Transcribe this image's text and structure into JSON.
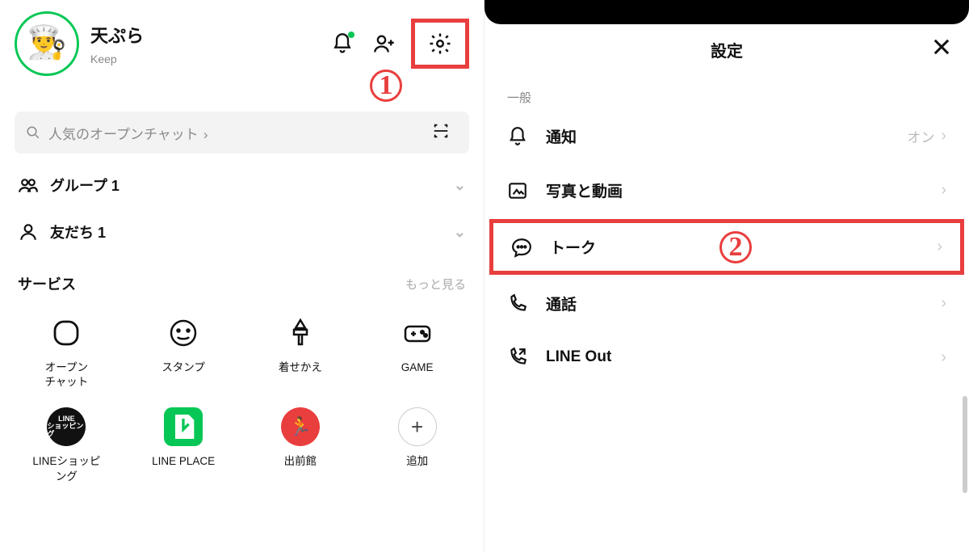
{
  "colors": {
    "accent_green": "#06C755",
    "annotation_red": "#E93E3E"
  },
  "annotations": {
    "step1": "1",
    "step2": "2"
  },
  "left": {
    "profile": {
      "name": "天ぷら",
      "keep": "Keep"
    },
    "search_placeholder": "人気のオープンチャット",
    "rows": {
      "groups": "グループ 1",
      "friends": "友だち 1"
    },
    "section": {
      "title": "サービス",
      "more": "もっと見る"
    },
    "services": [
      {
        "id": "openchat",
        "label": "オープン\nチャット"
      },
      {
        "id": "stamp",
        "label": "スタンプ"
      },
      {
        "id": "theme",
        "label": "着せかえ"
      },
      {
        "id": "game",
        "label": "GAME"
      },
      {
        "id": "shopping",
        "label": "LINEショッピ\nング",
        "pill_text_top": "LINE",
        "pill_text_bottom": "ショッピング"
      },
      {
        "id": "place",
        "label": "LINE PLACE"
      },
      {
        "id": "demae",
        "label": "出前館"
      },
      {
        "id": "add",
        "label": "追加"
      }
    ]
  },
  "right": {
    "title": "設定",
    "section_label": "一般",
    "items": [
      {
        "id": "notif",
        "label": "通知",
        "value": "オン"
      },
      {
        "id": "media",
        "label": "写真と動画"
      },
      {
        "id": "talk",
        "label": "トーク",
        "highlighted": true
      },
      {
        "id": "call",
        "label": "通話"
      },
      {
        "id": "lineout",
        "label": "LINE Out"
      }
    ]
  }
}
